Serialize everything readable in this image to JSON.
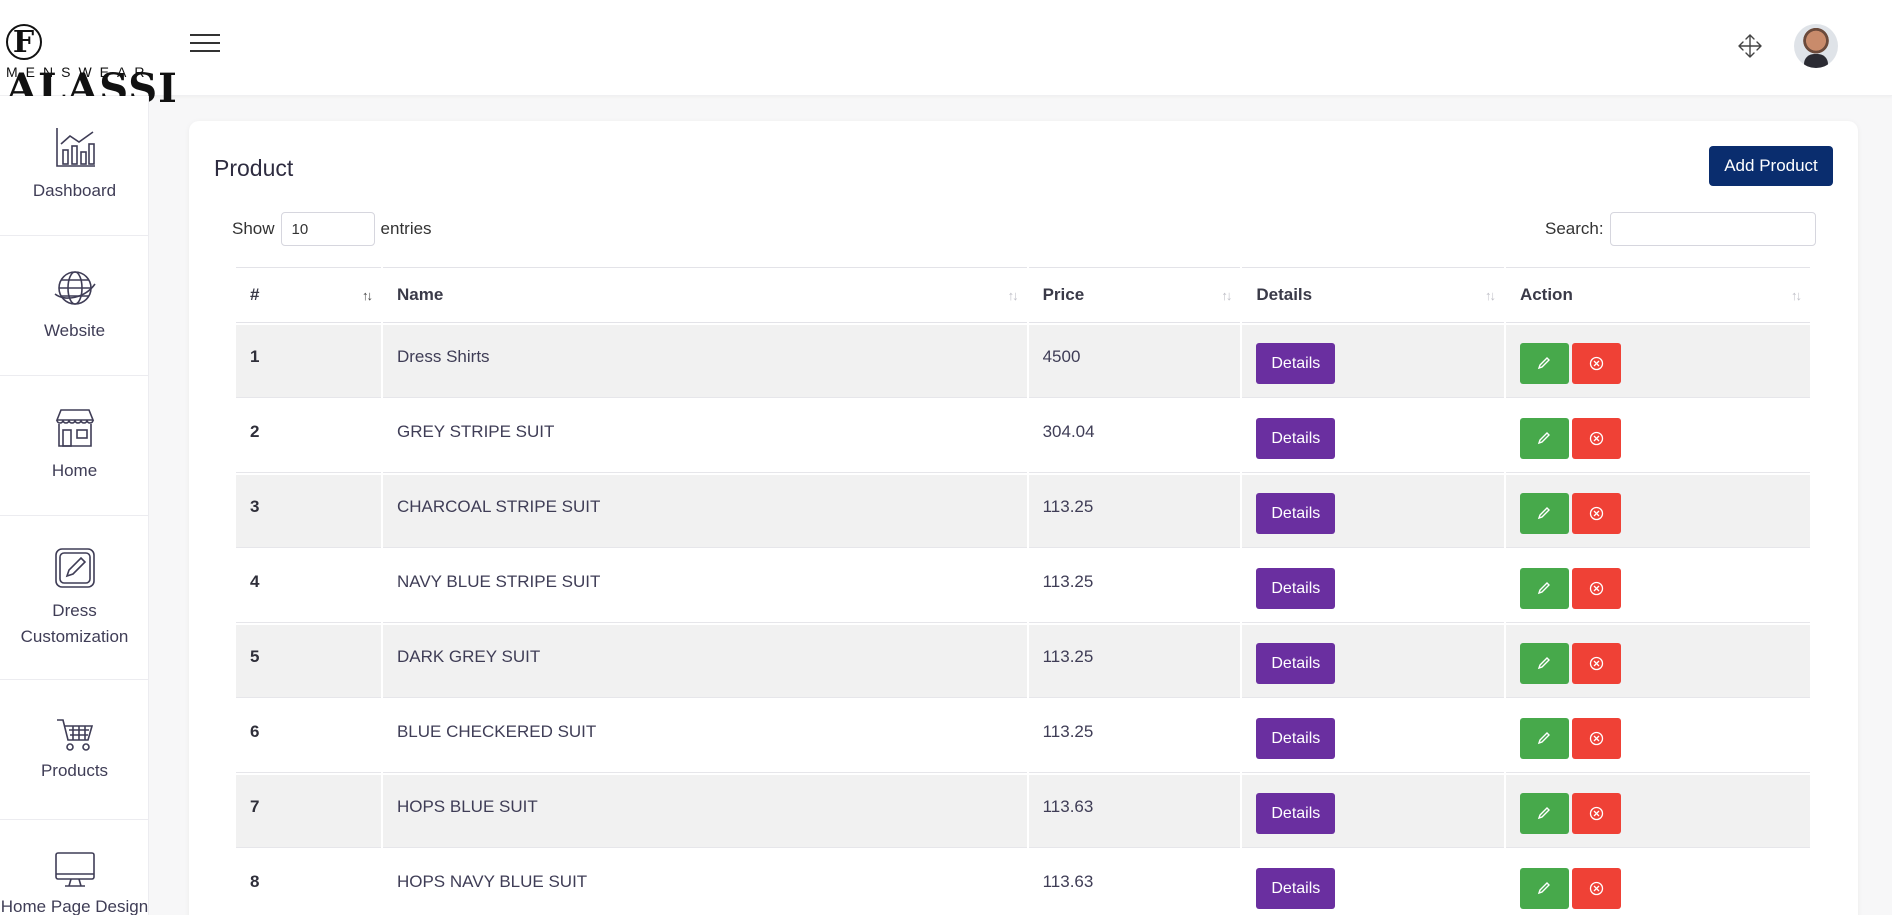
{
  "brand": {
    "logo_text": "ALASSI",
    "logo_letter": "F",
    "logo_sub": "MENSWEAR"
  },
  "header": {
    "menu_icon": "hamburger-icon",
    "fullscreen_icon": "move-arrows-icon",
    "avatar": "user-avatar"
  },
  "sidebar": {
    "items": [
      {
        "label": "Dashboard",
        "icon": "chart-icon"
      },
      {
        "label": "Website",
        "icon": "globe-icon"
      },
      {
        "label": "Home",
        "icon": "store-icon"
      },
      {
        "label": "Dress Customization",
        "icon": "pencil-square-icon"
      },
      {
        "label": "Products",
        "icon": "cart-icon"
      },
      {
        "label": "Home Page Design",
        "icon": "monitor-icon"
      }
    ]
  },
  "main": {
    "title": "Product",
    "add_button": "Add Product",
    "show_label": "Show",
    "entries_value": "10",
    "entries_label": "entries",
    "search_label": "Search:",
    "search_value": ""
  },
  "table": {
    "headers": [
      "#",
      "Name",
      "Price",
      "Details",
      "Action"
    ],
    "details_label": "Details",
    "rows": [
      {
        "num": "1",
        "name": "Dress Shirts",
        "price": "4500"
      },
      {
        "num": "2",
        "name": "GREY STRIPE SUIT",
        "price": "304.04"
      },
      {
        "num": "3",
        "name": "CHARCOAL STRIPE SUIT",
        "price": "113.25"
      },
      {
        "num": "4",
        "name": "NAVY BLUE STRIPE SUIT",
        "price": "113.25"
      },
      {
        "num": "5",
        "name": "DARK GREY SUIT",
        "price": "113.25"
      },
      {
        "num": "6",
        "name": "BLUE CHECKERED SUIT",
        "price": "113.25"
      },
      {
        "num": "7",
        "name": "HOPS BLUE SUIT",
        "price": "113.63"
      },
      {
        "num": "8",
        "name": "HOPS NAVY BLUE SUIT",
        "price": "113.63"
      }
    ]
  },
  "colors": {
    "primary": "#0a2d6e",
    "details": "#6a2fa0",
    "edit": "#47a94b",
    "delete": "#ef4136"
  }
}
